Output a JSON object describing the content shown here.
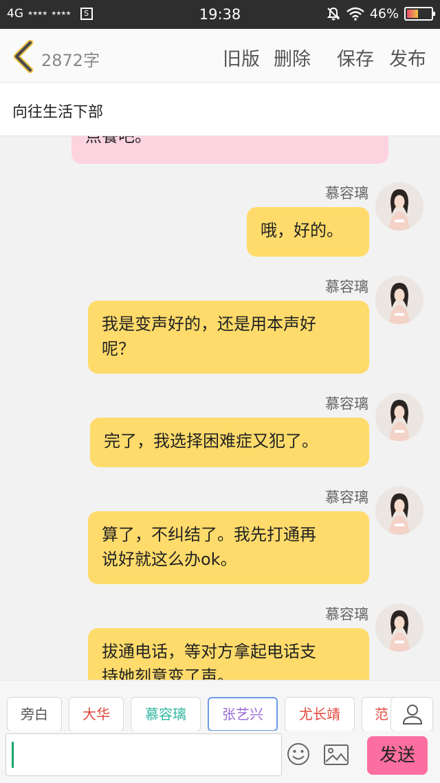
{
  "status_bar": {
    "network": "4G",
    "signal1": "★★★★",
    "signal2": "★★★★",
    "sim_icon": "S",
    "time": "19:38",
    "battery": "46%",
    "battery_level": 0.46,
    "icons": [
      "mute-icon",
      "wifi-icon",
      "battery-icon"
    ]
  },
  "header": {
    "word_count": "2872字",
    "actions": {
      "old_version": "旧版",
      "delete": "删除",
      "save": "保存",
      "publish": "发布"
    }
  },
  "title": "向往生活下部",
  "messages": [
    {
      "type": "partial",
      "text": "点餐吧。",
      "color": "pink"
    },
    {
      "sender": "慕容璃",
      "text": "哦，好的。"
    },
    {
      "sender": "慕容璃",
      "lines": [
        "我是变声好的，还是用本声好",
        "呢？"
      ]
    },
    {
      "sender": "慕容璃",
      "text": "完了，我选择困难症又犯了。"
    },
    {
      "sender": "慕容璃",
      "lines": [
        "算了，不纠结了。我先打通再",
        "说好就这么办ok。"
      ]
    },
    {
      "sender": "慕容璃",
      "lines": [
        "拔通电话，等对方拿起电话支",
        "持她刻意变了声。"
      ]
    }
  ],
  "roles": [
    {
      "label": "旁白",
      "color": "#555555"
    },
    {
      "label": "大华",
      "color": "#e2473c"
    },
    {
      "label": "慕容璃",
      "color": "#2fb6a2"
    },
    {
      "label": "张艺兴",
      "color": "#9a6bd6"
    },
    {
      "label": "尤长靖",
      "color": "#e2473c"
    },
    {
      "label": "范",
      "color": "#e2473c"
    }
  ],
  "input": {
    "value": "",
    "send": "发送"
  },
  "colors": {
    "bubble_yellow": "#fedb6b",
    "bubble_pink": "#fcd3df",
    "send_button": "#fb6fa0",
    "active_role_border": "#6b9ae6"
  }
}
